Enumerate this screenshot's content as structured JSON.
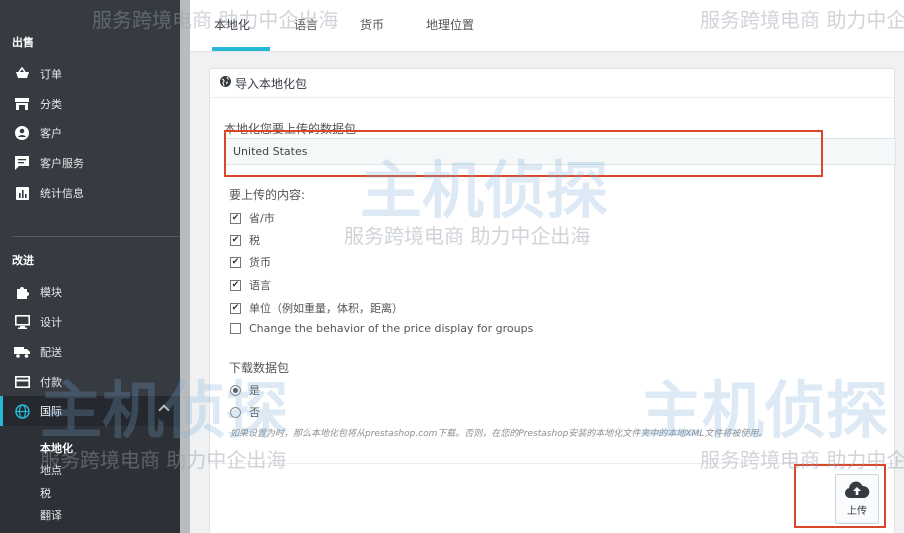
{
  "sidebar": {
    "section_sell": "出售",
    "items_sell": [
      {
        "label": "订单",
        "icon": "cart-icon"
      },
      {
        "label": "分类",
        "icon": "store-icon"
      },
      {
        "label": "客户",
        "icon": "user-icon"
      },
      {
        "label": "客户服务",
        "icon": "chat-icon"
      },
      {
        "label": "统计信息",
        "icon": "chart-icon"
      }
    ],
    "section_improve": "改进",
    "items_improve": [
      {
        "label": "模块",
        "icon": "puzzle-icon"
      },
      {
        "label": "设计",
        "icon": "monitor-icon"
      },
      {
        "label": "配送",
        "icon": "truck-icon"
      },
      {
        "label": "付款",
        "icon": "card-icon"
      },
      {
        "label": "国际",
        "icon": "globe-icon"
      }
    ],
    "submenu": [
      "本地化",
      "地点",
      "税",
      "翻译"
    ]
  },
  "tabs": [
    "本地化",
    "语言",
    "货币",
    "地理位置"
  ],
  "panel": {
    "title": "导入本地化包",
    "package_label": "本地化您要上传的数据包",
    "package_value": "United States",
    "content_label": "要上传的内容:",
    "content_options": [
      {
        "label": "省/市",
        "checked": true
      },
      {
        "label": "税",
        "checked": true
      },
      {
        "label": "货币",
        "checked": true
      },
      {
        "label": "语言",
        "checked": true
      },
      {
        "label": "单位（例如重量，体积，距离）",
        "checked": true
      },
      {
        "label": "Change the behavior of the price display for groups",
        "checked": false
      }
    ],
    "download_label": "下载数据包",
    "download_options": [
      {
        "label": "是",
        "selected": true
      },
      {
        "label": "否",
        "selected": false
      }
    ],
    "hint": "如果设置为时，那么本地化包将从prestashop.com下载。否则，在您的Prestashop安装的本地化文件夹中的本地XML文件将被使用。",
    "upload_label": "上传"
  },
  "watermark": {
    "text": "服务跨境电商  助力中企出海",
    "logo": "主机侦探"
  },
  "colors": {
    "sidebar_bg": "#363a41",
    "accent": "#25b9d7",
    "highlight": "#d9472b"
  }
}
